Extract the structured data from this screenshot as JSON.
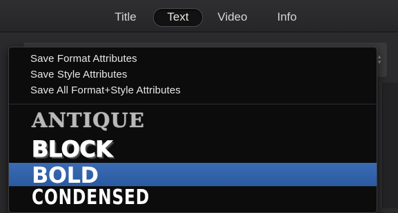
{
  "tabs": [
    {
      "label": "Title",
      "selected": false
    },
    {
      "label": "Text",
      "selected": true
    },
    {
      "label": "Video",
      "selected": false
    },
    {
      "label": "Info",
      "selected": false
    }
  ],
  "menu": {
    "actions": [
      "Save Format Attributes",
      "Save Style Attributes",
      "Save All Format+Style Attributes"
    ],
    "styles": [
      {
        "label": "ANTIQUE",
        "highlighted": false
      },
      {
        "label": "BLOCK",
        "highlighted": false
      },
      {
        "label": "BOLD",
        "highlighted": true
      },
      {
        "label": "CONDENSED",
        "highlighted": false
      }
    ]
  },
  "colors": {
    "highlight": "#2f5fa8",
    "menu_background": "#0c0c0d",
    "window_background": "#2b2b2d"
  }
}
